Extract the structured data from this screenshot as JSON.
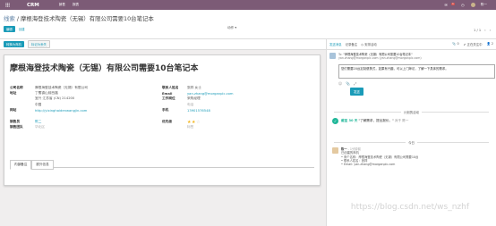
{
  "topbar": {
    "app_name": "CRM",
    "menu": [
      "销售",
      "报表"
    ],
    "chat_count": "1",
    "user_name": "陈一"
  },
  "breadcrumb": {
    "parent": "线索",
    "current": "摩根海登技术陶瓷（无锡）有限公司需要10台笔记本"
  },
  "buttons": {
    "edit": "编辑",
    "create": "创建",
    "action": "动作 ▾",
    "pager": "1 / 1"
  },
  "status_buttons": {
    "convert": "转换为商机",
    "mark_lost": "标记为丢失"
  },
  "record": {
    "title": "摩根海登技术陶瓷（无锡）有限公司需要10台笔记本",
    "left_fields": [
      {
        "label": "公司名称",
        "value": "摩根海登技术陶瓷（无锡）有限公司"
      },
      {
        "label": "地址",
        "value": "丁蜀镇山前西路"
      },
      {
        "label": "",
        "value": "宜兴  江苏省 (CN)  214200"
      },
      {
        "label": "",
        "value": "中国"
      },
      {
        "label": "网站",
        "value": "http://yixinghaidenwangjin.com"
      },
      {
        "label": "",
        "value": ""
      },
      {
        "label": "销售员",
        "value": "陈二"
      },
      {
        "label": "销售团队",
        "value": "华北区"
      }
    ],
    "right_fields": [
      {
        "label": "联系人姓名",
        "value": "张祥  女士"
      },
      {
        "label": "Email",
        "value": "yan.zhang@morganplc.com"
      },
      {
        "label": "工作岗位",
        "value": "采购经理"
      },
      {
        "label": "",
        "value": "电话"
      },
      {
        "label": "手机",
        "value": "13901576548"
      },
      {
        "label": "",
        "value": ""
      },
      {
        "label": "优先级",
        "value": ""
      },
      {
        "label": "",
        "value": "标签"
      }
    ],
    "priority": 2,
    "priority_max": 3
  },
  "tabs": [
    "内部备注",
    "额外信息"
  ],
  "chatter": {
    "toolbar": {
      "send_message": "发送消息",
      "log_note": "记录备注",
      "schedule": "安排活动",
      "attachments": "0",
      "following": "✔ 正在关注中",
      "followers": "2"
    },
    "composer": {
      "to_prefix": "To:",
      "subject": "\"摩根海登技术陶瓷（无锡）有限公司需要10台笔记本\"",
      "recipient": "yan.zhang@morganplc.com  (yan.zhang@morganplc.com)",
      "body": "您们需要20台定制便携式，如果有兴趣，可以上门拜访，了解一下具体的需求。",
      "send_label": "发送"
    },
    "planned_label": "计划的活动",
    "activity": {
      "due": "截至 30 天",
      "text": "\"了解需求，提出报价。\"",
      "who": "对于 陈一"
    },
    "today_label": "今日",
    "message": {
      "author": "陈一",
      "time": "- 1分钟前",
      "line1": "已创建的商机",
      "line2": "• 商个名称：摩根海登技术陶瓷（无锡）有限公司需要10台",
      "line3": "• 联系人姓名：张祥",
      "line4": "• Email: yan.zhang@morganplc.com"
    }
  },
  "watermark": "https://blog.csdn.net/ws_nzhf"
}
